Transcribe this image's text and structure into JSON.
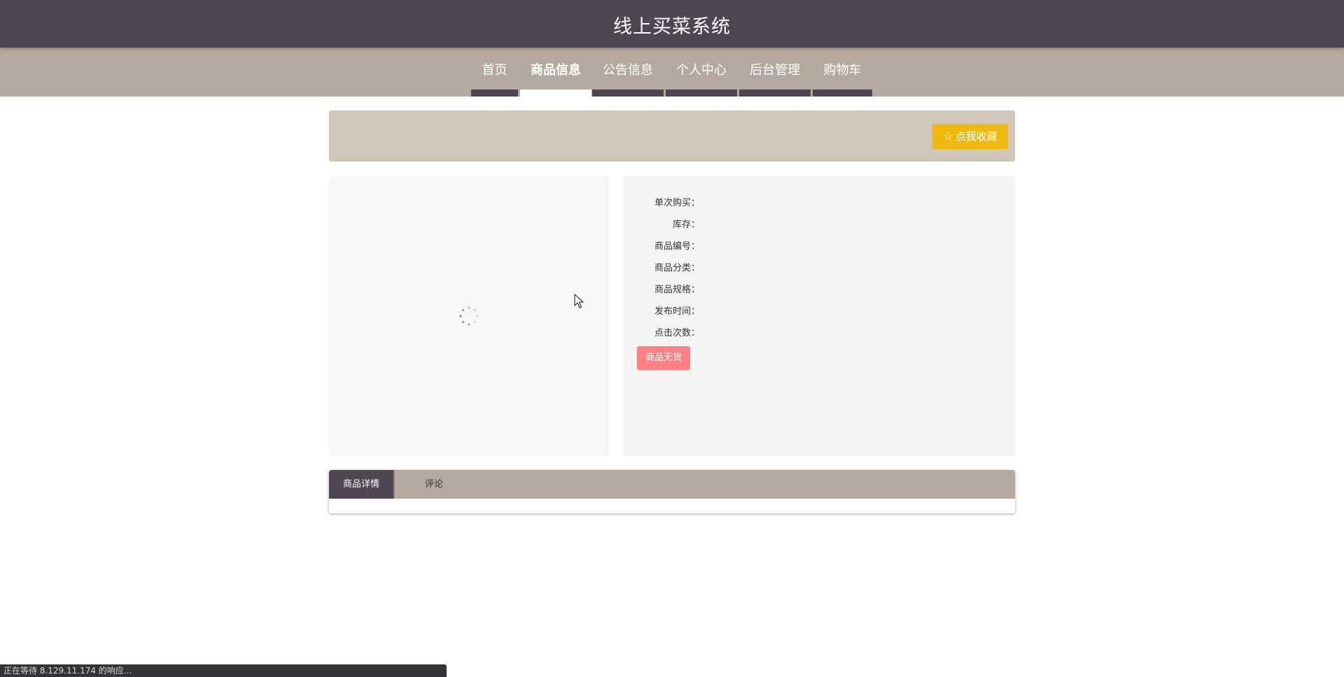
{
  "header": {
    "title": "线上买菜系统"
  },
  "nav": {
    "items": [
      {
        "label": "首页"
      },
      {
        "label": "商品信息"
      },
      {
        "label": "公告信息"
      },
      {
        "label": "个人中心"
      },
      {
        "label": "后台管理"
      },
      {
        "label": "购物车"
      }
    ],
    "active_index": 1
  },
  "banner": {
    "favorite_button": "点我收藏"
  },
  "product_info": {
    "fields": [
      {
        "label": "单次购买：",
        "value": ""
      },
      {
        "label": "库存：",
        "value": ""
      },
      {
        "label": "商品编号：",
        "value": ""
      },
      {
        "label": "商品分类：",
        "value": ""
      },
      {
        "label": "商品规格：",
        "value": ""
      },
      {
        "label": "发布时间：",
        "value": ""
      },
      {
        "label": "点击次数：",
        "value": ""
      }
    ],
    "soldout_button": "商品无货"
  },
  "tabs": [
    {
      "label": "商品详情"
    },
    {
      "label": "评论"
    }
  ],
  "status_bar": {
    "text": "正在等待 8.129.11.174 的响应..."
  },
  "colors": {
    "header_bg": "#4e4753",
    "nav_bg": "#b5a89f",
    "banner_bg": "#cfc5b9",
    "favorite_button": "#f0b90f",
    "soldout_button": "#ff7f82"
  }
}
